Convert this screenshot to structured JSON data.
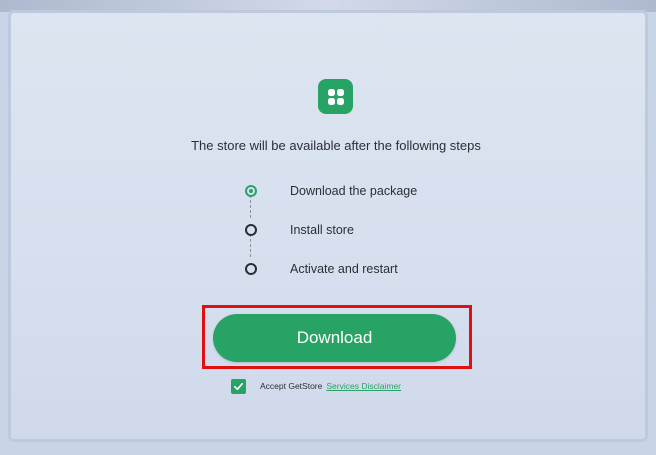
{
  "app": {
    "icon": "four-leaf-grid-icon",
    "accent_color": "#27a366"
  },
  "headline": "The store will be available after the following steps",
  "steps": [
    {
      "label": "Download the package",
      "state": "active"
    },
    {
      "label": "Install store",
      "state": "pending"
    },
    {
      "label": "Activate and restart",
      "state": "pending"
    }
  ],
  "download_button": {
    "label": "Download"
  },
  "accept": {
    "checked": true,
    "text": "Accept GetStore",
    "link_text": "Services Disclaimer"
  },
  "highlight_color": "#e01010"
}
